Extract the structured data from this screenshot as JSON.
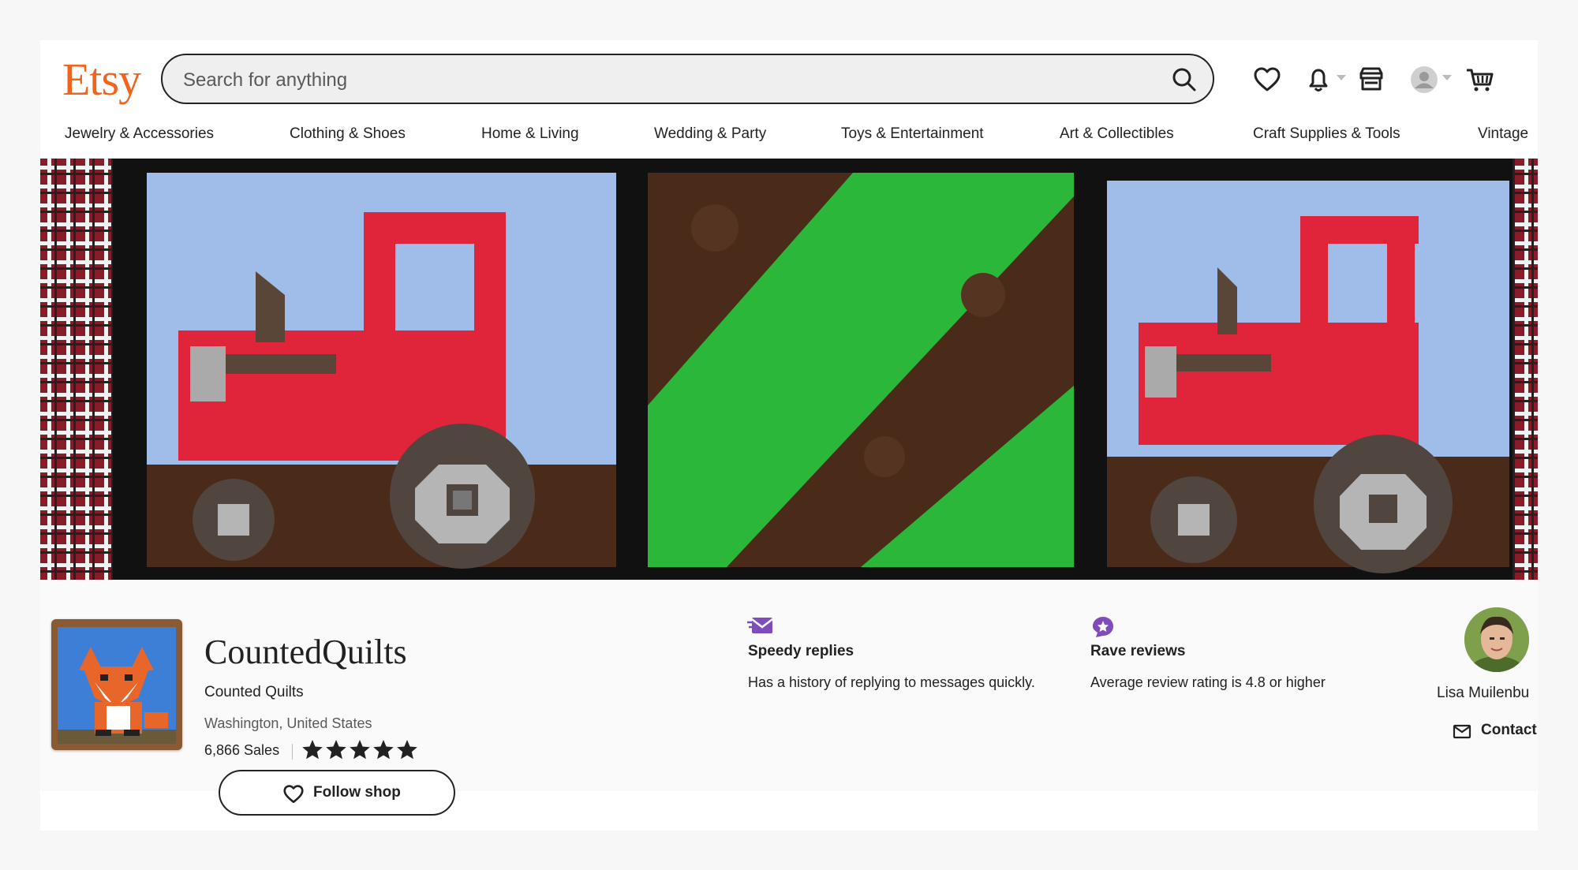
{
  "header": {
    "logo": "Etsy",
    "search": {
      "placeholder": "Search for anything"
    },
    "icons": [
      "heart-icon",
      "bell-icon",
      "shop-manager-icon",
      "account-icon",
      "cart-icon"
    ]
  },
  "categories": [
    "Jewelry & Accessories",
    "Clothing & Shoes",
    "Home & Living",
    "Wedding & Party",
    "Toys & Entertainment",
    "Art & Collectibles",
    "Craft Supplies & Tools",
    "Vintage"
  ],
  "shop": {
    "name": "CountedQuilts",
    "title": "Counted Quilts",
    "location": "Washington, United States",
    "sales": "6,866 Sales",
    "rating_stars": 5,
    "follow_label": "Follow shop"
  },
  "badges": [
    {
      "title": "Speedy replies",
      "description": "Has a history of replying to messages quickly.",
      "color": "#7f4cbb"
    },
    {
      "title": "Rave reviews",
      "description": "Average review rating is 4.8 or higher",
      "color": "#7f4cbb"
    }
  ],
  "owner": {
    "name": "Lisa Muilenbu",
    "contact_label": "Contact"
  },
  "colors": {
    "brand": "#f1641e",
    "text": "#222222",
    "badge": "#7f4cbb"
  }
}
